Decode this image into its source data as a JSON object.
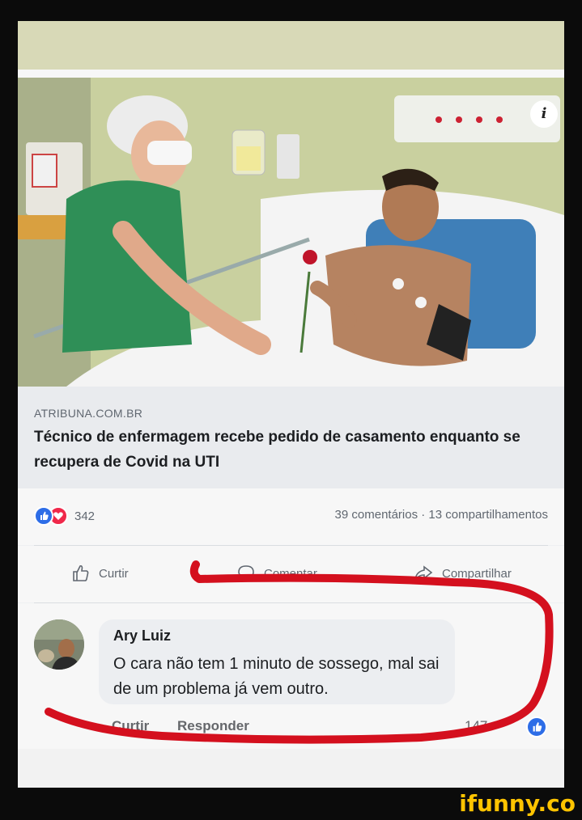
{
  "link_preview": {
    "source": "ATRIBUNA.COM.BR",
    "headline": "Técnico de enfermagem recebe pedido de casamento enquanto se recupera de Covid na UTI",
    "info_icon": "i"
  },
  "stats": {
    "reaction_count": "342",
    "comments_shares": "39 comentários · 13 compartilhamentos"
  },
  "actions": {
    "like_label": "Curtir",
    "comment_label": "Comentar",
    "share_label": "Compartilhar"
  },
  "comment": {
    "author": "Ary Luiz",
    "text": "O cara não tem 1 minuto de sossego, mal sai de um problema já vem outro.",
    "like_label": "Curtir",
    "reply_label": "Responder",
    "reaction_count": "147"
  },
  "watermark": "ifunny.co",
  "colors": {
    "facebook_blue": "#2d6de7",
    "love_red": "#f0284a",
    "annotation_red": "#d4101e",
    "watermark_yellow": "#ffc400"
  }
}
